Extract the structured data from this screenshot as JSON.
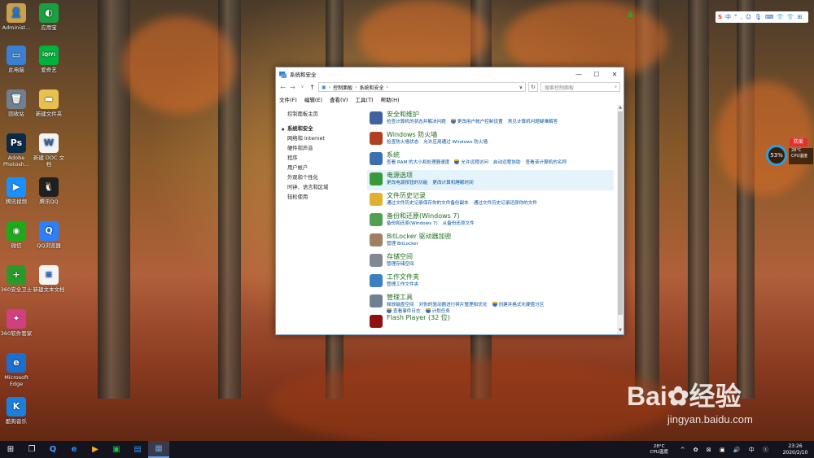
{
  "desktop": {
    "icons": [
      {
        "label": "Administ...",
        "glyph": "👤",
        "color": "#c8a050"
      },
      {
        "label": "应用宝",
        "glyph": "◐",
        "color": "#1aa040"
      },
      {
        "label": "此电脑",
        "glyph": "▭",
        "color": "#3a80d0"
      },
      {
        "label": "爱奇艺",
        "glyph": "iQIYI",
        "color": "#00b33c"
      },
      {
        "label": "回收站",
        "glyph": "🗑",
        "color": "#708090"
      },
      {
        "label": "新建文件夹",
        "glyph": "▬",
        "color": "#e8c050"
      },
      {
        "label": "Adobe Photosh...",
        "glyph": "Ps",
        "color": "#0a2a4a"
      },
      {
        "label": "新建 DOC 文档",
        "glyph": "W",
        "color": "#f4f4f4"
      },
      {
        "label": "腾讯视频",
        "glyph": "▶",
        "color": "#1a90ff"
      },
      {
        "label": "腾讯QQ",
        "glyph": "🐧",
        "color": "#202020"
      },
      {
        "label": "微信",
        "glyph": "◉",
        "color": "#1aad19"
      },
      {
        "label": "QQ浏览器",
        "glyph": "Q",
        "color": "#2a80ff"
      },
      {
        "label": "360安全卫士",
        "glyph": "+",
        "color": "#2a9a2a"
      },
      {
        "label": "新建文本文档",
        "glyph": "≡",
        "color": "#f4f4f4"
      },
      {
        "label": "360软件管家",
        "glyph": "✦",
        "color": "#d04080"
      },
      {
        "label": "Microsoft Edge",
        "glyph": "e",
        "color": "#1a70d0"
      },
      {
        "label": "酷狗音乐",
        "glyph": "K",
        "color": "#1a80e0"
      }
    ]
  },
  "window": {
    "title": "系统和安全",
    "address": [
      "控制面板",
      "系统和安全"
    ],
    "search_placeholder": "搜索控制面板",
    "menu": [
      "文件(F)",
      "编辑(E)",
      "查看(V)",
      "工具(T)",
      "帮助(H)"
    ],
    "leftnav": {
      "home": "控制面板主页",
      "items": [
        "系统和安全",
        "网络和 Internet",
        "硬件和声音",
        "程序",
        "用户帐户",
        "外观和个性化",
        "时钟、语言和区域",
        "轻松使用"
      ]
    },
    "categories": [
      {
        "title": "安全和维护",
        "icon_color": "#4060a0",
        "links": [
          {
            "t": "检查计算机的状态并解决问题"
          },
          {
            "t": "更改用户帐户控制设置",
            "shield": true
          },
          {
            "t": "常见计算机问题疑难解答"
          }
        ]
      },
      {
        "title": "Windows 防火墙",
        "icon_color": "#b04020",
        "links": [
          {
            "t": "检查防火墙状态"
          },
          {
            "t": "允许应用通过 Windows 防火墙"
          }
        ]
      },
      {
        "title": "系统",
        "icon_color": "#3a70b0",
        "links": [
          {
            "t": "查看 RAM 的大小和处理器速度"
          },
          {
            "t": "允许远程访问",
            "shield": true
          },
          {
            "t": "启动远程协助"
          },
          {
            "t": "查看该计算机的名称"
          }
        ]
      },
      {
        "title": "电源选项",
        "icon_color": "#3a9a3a",
        "highlight": true,
        "links": [
          {
            "t": "更改电源按钮的功能"
          },
          {
            "t": "更改计算机睡眠时间"
          }
        ]
      },
      {
        "title": "文件历史记录",
        "icon_color": "#e0b030",
        "links": [
          {
            "t": "通过文件历史记录保存你的文件备份副本"
          },
          {
            "t": "通过文件历史记录还原你的文件"
          }
        ]
      },
      {
        "title": "备份和还原(Windows 7)",
        "icon_color": "#50a050",
        "links": [
          {
            "t": "备份和还原(Windows 7)"
          },
          {
            "t": "从备份还原文件"
          }
        ]
      },
      {
        "title": "BitLocker 驱动器加密",
        "icon_color": "#a08060",
        "links": [
          {
            "t": "管理 BitLocker"
          }
        ]
      },
      {
        "title": "存储空间",
        "icon_color": "#808890",
        "links": [
          {
            "t": "管理存储空间"
          }
        ]
      },
      {
        "title": "工作文件夹",
        "icon_color": "#3a80c0",
        "links": [
          {
            "t": "管理工作文件夹"
          }
        ]
      },
      {
        "title": "管理工具",
        "icon_color": "#708090",
        "links": [
          {
            "t": "释放磁盘空间"
          },
          {
            "t": "对你的驱动器进行碎片整理和优化"
          },
          {
            "t": "创建并格式化硬盘分区",
            "shield": true
          },
          {
            "t": "查看事件日志",
            "shield": true,
            "br": true
          },
          {
            "t": "计划任务",
            "shield": true
          }
        ]
      },
      {
        "title": "Flash Player (32 位)",
        "icon_color": "#901010",
        "links": []
      }
    ]
  },
  "widget": {
    "percent": "53%",
    "temp": "28°C",
    "cpu_label": "CPU温度",
    "speed_label": "防爱"
  },
  "taskbar": {
    "weather_temp": "28°C",
    "weather_label": "CPU温度",
    "time": "23:26",
    "date": "2020/2/10"
  },
  "watermark": {
    "brand": "Bai",
    "brand2": "经验",
    "url": "jingyan.baidu.com"
  },
  "imebar": {
    "items": [
      "S",
      "中",
      "°",
      ",",
      "☺",
      "🎙",
      "⌨",
      "👕",
      "👕",
      "⊞"
    ]
  }
}
